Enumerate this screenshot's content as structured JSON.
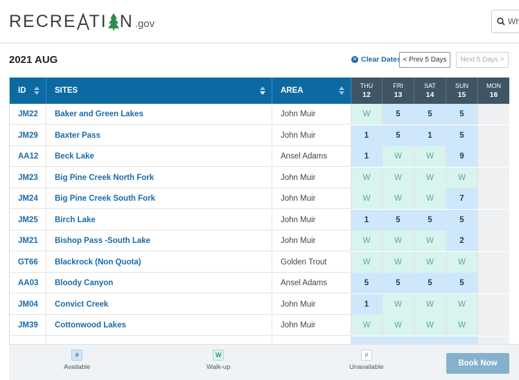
{
  "header": {
    "logo_text_a": "RECRE",
    "logo_text_b": "TI",
    "logo_text_c": "N",
    "logo_suffix": ".gov",
    "search_placeholder": "Wh"
  },
  "toolbar": {
    "month": "2021 AUG",
    "clear_dates": "Clear Dates",
    "prev": "< Prev 5 Days",
    "next": "Next 5 Days >"
  },
  "columns": {
    "id": "ID",
    "sites": "SITES",
    "area": "AREA",
    "days": [
      {
        "name": "THU",
        "num": "12"
      },
      {
        "name": "FRI",
        "num": "13"
      },
      {
        "name": "SAT",
        "num": "14"
      },
      {
        "name": "SUN",
        "num": "15"
      },
      {
        "name": "MON",
        "num": "16"
      }
    ]
  },
  "rows": [
    {
      "id": "JM22",
      "site": "Baker and Green Lakes",
      "area": "John Muir",
      "days": [
        "W",
        "5",
        "5",
        "5",
        ""
      ]
    },
    {
      "id": "JM29",
      "site": "Baxter Pass",
      "area": "John Muir",
      "days": [
        "1",
        "5",
        "1",
        "5",
        ""
      ]
    },
    {
      "id": "AA12",
      "site": "Beck Lake",
      "area": "Ansel Adams",
      "days": [
        "1",
        "W",
        "W",
        "9",
        ""
      ]
    },
    {
      "id": "JM23",
      "site": "Big Pine Creek North Fork",
      "area": "John Muir",
      "days": [
        "W",
        "W",
        "W",
        "W",
        ""
      ]
    },
    {
      "id": "JM24",
      "site": "Big Pine Creek South Fork",
      "area": "John Muir",
      "days": [
        "W",
        "W",
        "W",
        "7",
        ""
      ]
    },
    {
      "id": "JM25",
      "site": "Birch Lake",
      "area": "John Muir",
      "days": [
        "1",
        "5",
        "5",
        "5",
        ""
      ]
    },
    {
      "id": "JM21",
      "site": "Bishop Pass -South Lake",
      "area": "John Muir",
      "days": [
        "W",
        "W",
        "W",
        "2",
        ""
      ]
    },
    {
      "id": "GT66",
      "site": "Blackrock (Non Quota)",
      "area": "Golden Trout",
      "days": [
        "W",
        "W",
        "W",
        "W",
        ""
      ]
    },
    {
      "id": "AA03",
      "site": "Bloody Canyon",
      "area": "Ansel Adams",
      "days": [
        "5",
        "5",
        "5",
        "5",
        ""
      ]
    },
    {
      "id": "JM04",
      "site": "Convict Creek",
      "area": "John Muir",
      "days": [
        "1",
        "W",
        "W",
        "W",
        ""
      ]
    },
    {
      "id": "JM39",
      "site": "Cottonwood Lakes",
      "area": "John Muir",
      "days": [
        "W",
        "W",
        "W",
        "W",
        ""
      ]
    },
    {
      "id": "",
      "site": "",
      "area": "",
      "days": [
        "",
        "",
        "",
        "",
        ""
      ]
    }
  ],
  "legend": {
    "available_symbol": "#",
    "available_label": "Available",
    "walkup_symbol": "W",
    "walkup_label": "Walk-up",
    "unavailable_symbol": "#",
    "unavailable_label": "Unavailable"
  },
  "book_now": "Book Now",
  "colors": {
    "header_blue": "#0b6aa2",
    "day_header": "#3f5563",
    "available": "#cfe7fb",
    "walkup": "#d9f3ef",
    "unavailable": "#eef0f2",
    "link": "#1a6aa8",
    "book_button": "#86b1cc"
  }
}
